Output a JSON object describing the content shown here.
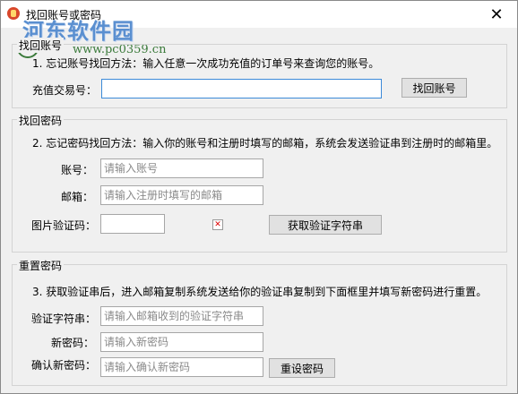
{
  "window": {
    "title": "找回账号或密码",
    "close_glyph": "✕",
    "icon": "app-icon"
  },
  "watermark": {
    "title": "河东软件园",
    "url": "www.pc0359.cn"
  },
  "recover_account": {
    "legend": "找回账号",
    "hint": "1. 忘记账号找回方法：输入任意一次成功充值的订单号来查询您的账号。",
    "order_label": "充值交易号：",
    "order_value": "",
    "button": "找回账号"
  },
  "recover_password": {
    "legend": "找回密码",
    "hint": "2. 忘记密码找回方法：输入你的账号和注册时填写的邮箱，系统会发送验证串到注册时的邮箱里。",
    "account_label": "账号：",
    "account_placeholder": "请输入账号",
    "email_label": "邮箱：",
    "email_placeholder": "请输入注册时填写的邮箱",
    "captcha_label": "图片验证码：",
    "captcha_value": "",
    "captcha_image": "broken-image-icon",
    "button": "获取验证字符串"
  },
  "reset_password": {
    "legend": "重置密码",
    "hint": "3. 获取验证串后，进入邮箱复制系统发送给你的验证串复制到下面框里并填写新密码进行重置。",
    "verify_label": "验证字符串：",
    "verify_placeholder": "请输入邮箱收到的验证字符串",
    "newpwd_label": "新密码：",
    "newpwd_placeholder": "请输入新密码",
    "confirm_label": "确认新密码：",
    "confirm_placeholder": "请输入确认新密码",
    "button": "重设密码"
  },
  "colors": {
    "window_bg": "#f0f0f0",
    "button_bg": "#e1e1e1",
    "focus_border": "#3c8ad8",
    "watermark_blue": "#5a8fd0",
    "watermark_green": "#3a7a3a"
  }
}
